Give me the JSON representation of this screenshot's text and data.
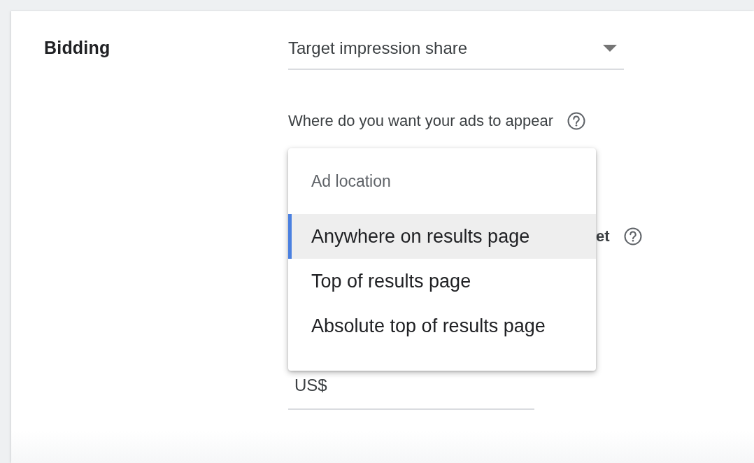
{
  "section": {
    "label": "Bidding"
  },
  "bid_strategy": {
    "value": "Target impression share"
  },
  "location_question": {
    "label": "Where do you want your ads to appear"
  },
  "covered_field": {
    "label": "et"
  },
  "amount_field": {
    "prefix": "US$"
  },
  "location_menu": {
    "header": "Ad location",
    "options": [
      {
        "label": "Anywhere on results page",
        "selected": true
      },
      {
        "label": "Top of results page",
        "selected": false
      },
      {
        "label": "Absolute top of results page",
        "selected": false
      }
    ]
  }
}
